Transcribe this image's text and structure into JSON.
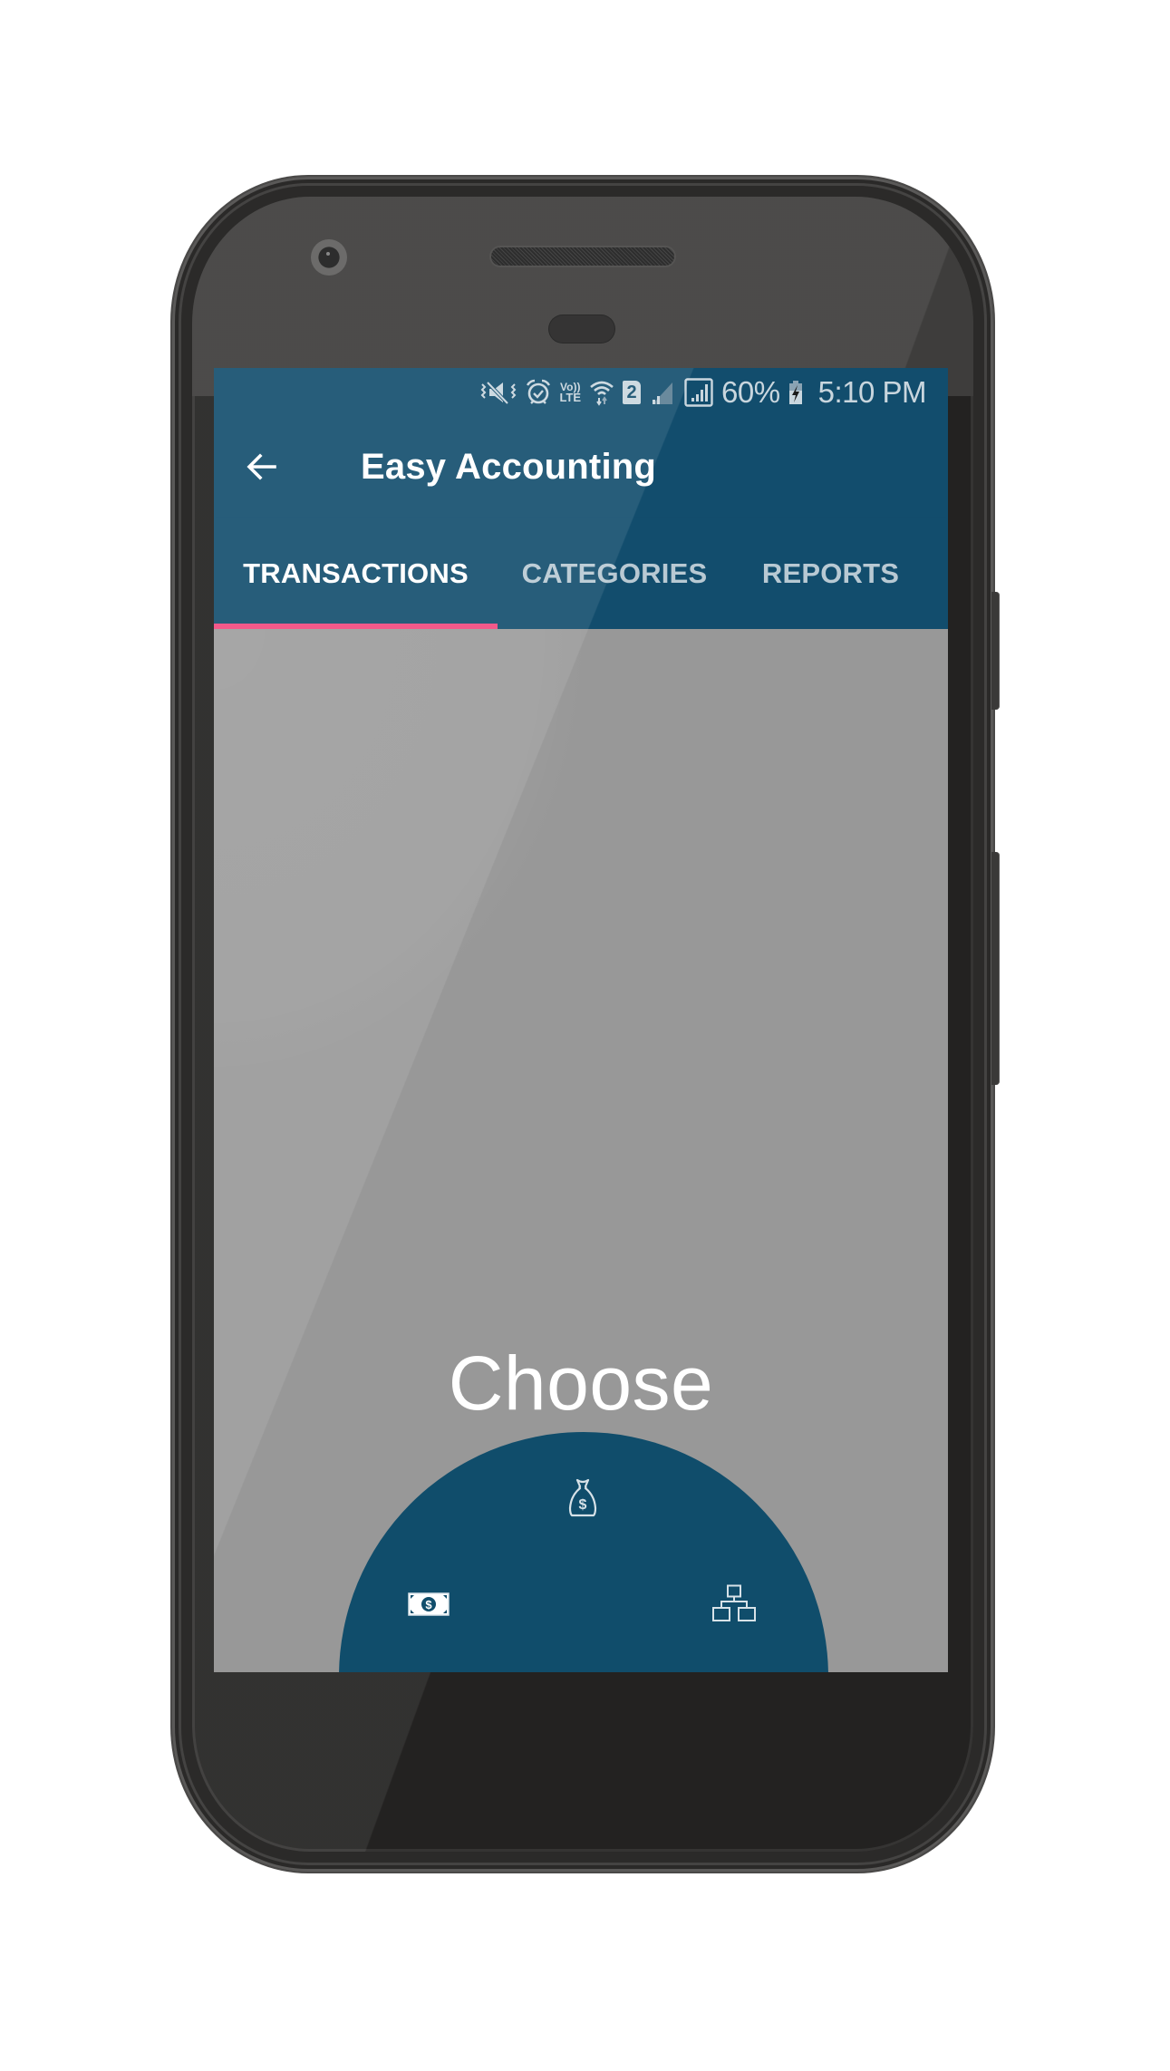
{
  "status_bar": {
    "icons": [
      "vibrate-mute-icon",
      "alarm-icon",
      "volte-icon",
      "wifi-icon",
      "sim-2-icon",
      "signal-weak-icon",
      "signal-full-icon",
      "battery-charging-icon"
    ],
    "volte_top": "Vo))",
    "volte_bottom": "LTE",
    "sim_label": "2",
    "battery_percent": "60%",
    "time": "5:10 PM"
  },
  "app_bar": {
    "back_icon": "arrow-left-icon",
    "title": "Easy Accounting"
  },
  "tabs": [
    {
      "label": "TRANSACTIONS",
      "active": true
    },
    {
      "label": "CATEGORIES",
      "active": false
    },
    {
      "label": "REPORTS",
      "active": false
    }
  ],
  "main": {
    "prompt": "Choose",
    "menu_items": [
      {
        "icon": "money-bag-icon",
        "meaning": "income"
      },
      {
        "icon": "banknote-icon",
        "meaning": "transaction"
      },
      {
        "icon": "hierarchy-icon",
        "meaning": "category"
      }
    ]
  },
  "colors": {
    "primary": "#124d6d",
    "accent": "#f2497e",
    "overlay": "#989898",
    "text_on_primary": "#ffffff",
    "inactive_tab": "#b8c9d3"
  }
}
